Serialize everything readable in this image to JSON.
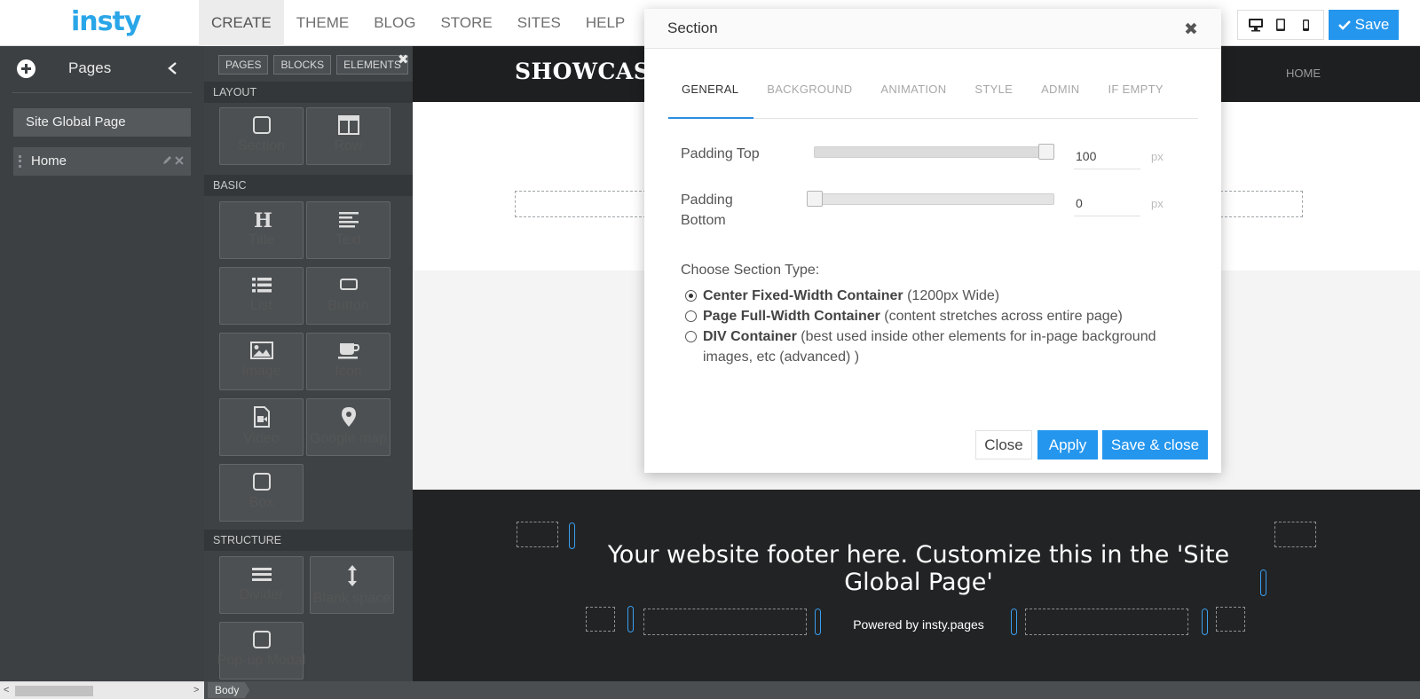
{
  "app": {
    "logo": "insty",
    "nav": [
      "CREATE",
      "THEME",
      "BLOG",
      "STORE",
      "SITES",
      "HELP"
    ],
    "save_label": "Save"
  },
  "pages_panel": {
    "title": "Pages",
    "items": [
      "Site Global Page",
      "Home"
    ]
  },
  "elements_panel": {
    "tabs": [
      "PAGES",
      "BLOCKS",
      "ELEMENTS"
    ],
    "sections": {
      "layout": "LAYOUT",
      "basic": "BASIC",
      "structure": "STRUCTURE"
    },
    "layout_items": [
      "Section",
      "Row"
    ],
    "basic_items": [
      "Title",
      "Text",
      "List",
      "Button",
      "Image",
      "Icon",
      "Video",
      "Google map",
      "Box"
    ],
    "structure_items": [
      "Divider",
      "Blank space",
      "Pop-up Modal"
    ]
  },
  "canvas": {
    "site_title": "SHOWCASE",
    "nav_home": "HOME",
    "footer_text": "Your website footer here. Customize this in the 'Site Global Page'",
    "footer_sub": "Powered by insty.pages"
  },
  "modal": {
    "title": "Section",
    "tabs": [
      "GENERAL",
      "BACKGROUND",
      "ANIMATION",
      "STYLE",
      "ADMIN",
      "IF EMPTY"
    ],
    "padding_top_label": "Padding Top",
    "padding_top_value": "100",
    "padding_top_fraction": 1.0,
    "padding_bottom_label_1": "Padding",
    "padding_bottom_label_2": "Bottom",
    "padding_bottom_value": "0",
    "padding_bottom_fraction": 0.0,
    "unit": "px",
    "choose_label": "Choose Section Type:",
    "options": [
      {
        "bold": "Center Fixed-Width Container",
        "rest": " (1200px Wide)",
        "selected": true
      },
      {
        "bold": "Page Full-Width Container",
        "rest": " (content stretches across entire page)",
        "selected": false
      },
      {
        "bold": "DIV Container",
        "rest": " (best used inside other elements for in-page background images, etc (advanced) )",
        "selected": false
      }
    ],
    "buttons": {
      "close": "Close",
      "apply": "Apply",
      "save_close": "Save & close"
    }
  },
  "breadcrumb": "Body",
  "colors": {
    "accent": "#2496ee",
    "logo": "#2aa6e8"
  }
}
